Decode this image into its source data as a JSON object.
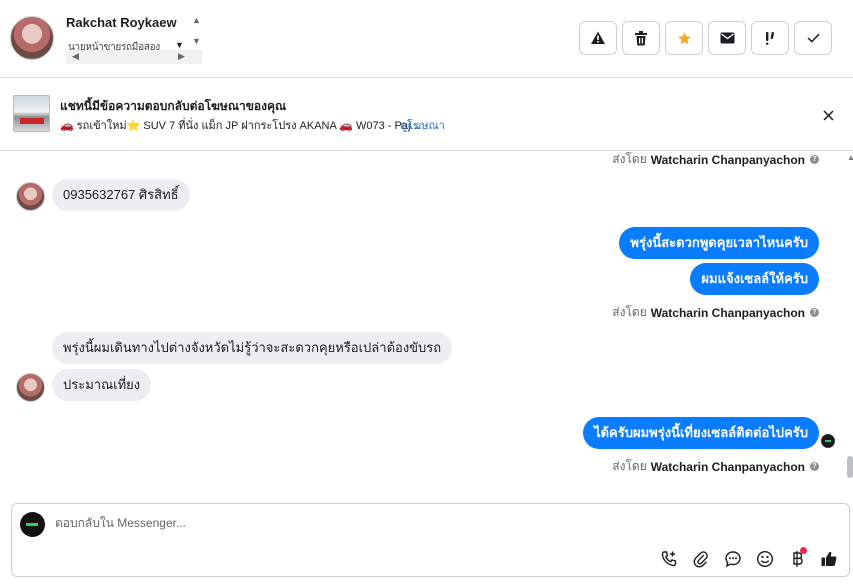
{
  "header": {
    "contact_name": "Rakchat Roykaew",
    "subtitle": "นายหน้าขายรถมือสอง"
  },
  "actions": {
    "icons": [
      "warning-icon",
      "trash-icon",
      "star-icon",
      "envelope-icon",
      "follow-up-icon",
      "check-icon"
    ],
    "star_color": "#f5a623"
  },
  "banner": {
    "title": "แชทนี้มีข้อความตอบกลับต่อโฆษณาของคุณ",
    "ad_text": "🚗 รถเข้าใหม่⭐ SUV 7 ที่นั่ง แม็ก JP ฝากระโปรง AKANA 🚗 W073 - Paj...",
    "link_label": "ดูโฆษณา"
  },
  "messages": {
    "sent_by_prefix": "ส่งโดย",
    "sender_name": "Watcharin Chanpanyachon",
    "items": [
      {
        "dir": "in",
        "text": "0935632767   ศิรสิทธิ์"
      },
      {
        "dir": "out",
        "text": "พรุ่งนี้สะดวกพูดคุยเวลาไหนครับ"
      },
      {
        "dir": "out",
        "text": "ผมแจ้งเซลล์ให้ครับ"
      },
      {
        "dir": "in",
        "text": "พรุ่งนี้ผมเดินทางไปต่างจังหวัดไม่รู้ว่าจะสะดวกคุยหรือเปล่าต้องขับรถ"
      },
      {
        "dir": "in",
        "text": "ประมาณเที่ยง"
      },
      {
        "dir": "out",
        "text": "ได้ครับผมพรุ่งนี้เที่ยงเซลล์ติดต่อไปครับ"
      }
    ],
    "bubble_out_color": "#0a7cff",
    "bubble_in_color": "#eceef1"
  },
  "composer": {
    "placeholder": "ตอบกลับใน Messenger...",
    "tools": [
      "phone-plus-icon",
      "paperclip-icon",
      "saved-reply-icon",
      "emoji-icon",
      "baht-payment-icon",
      "like-icon"
    ],
    "notification_dot_color": "#f02849"
  }
}
